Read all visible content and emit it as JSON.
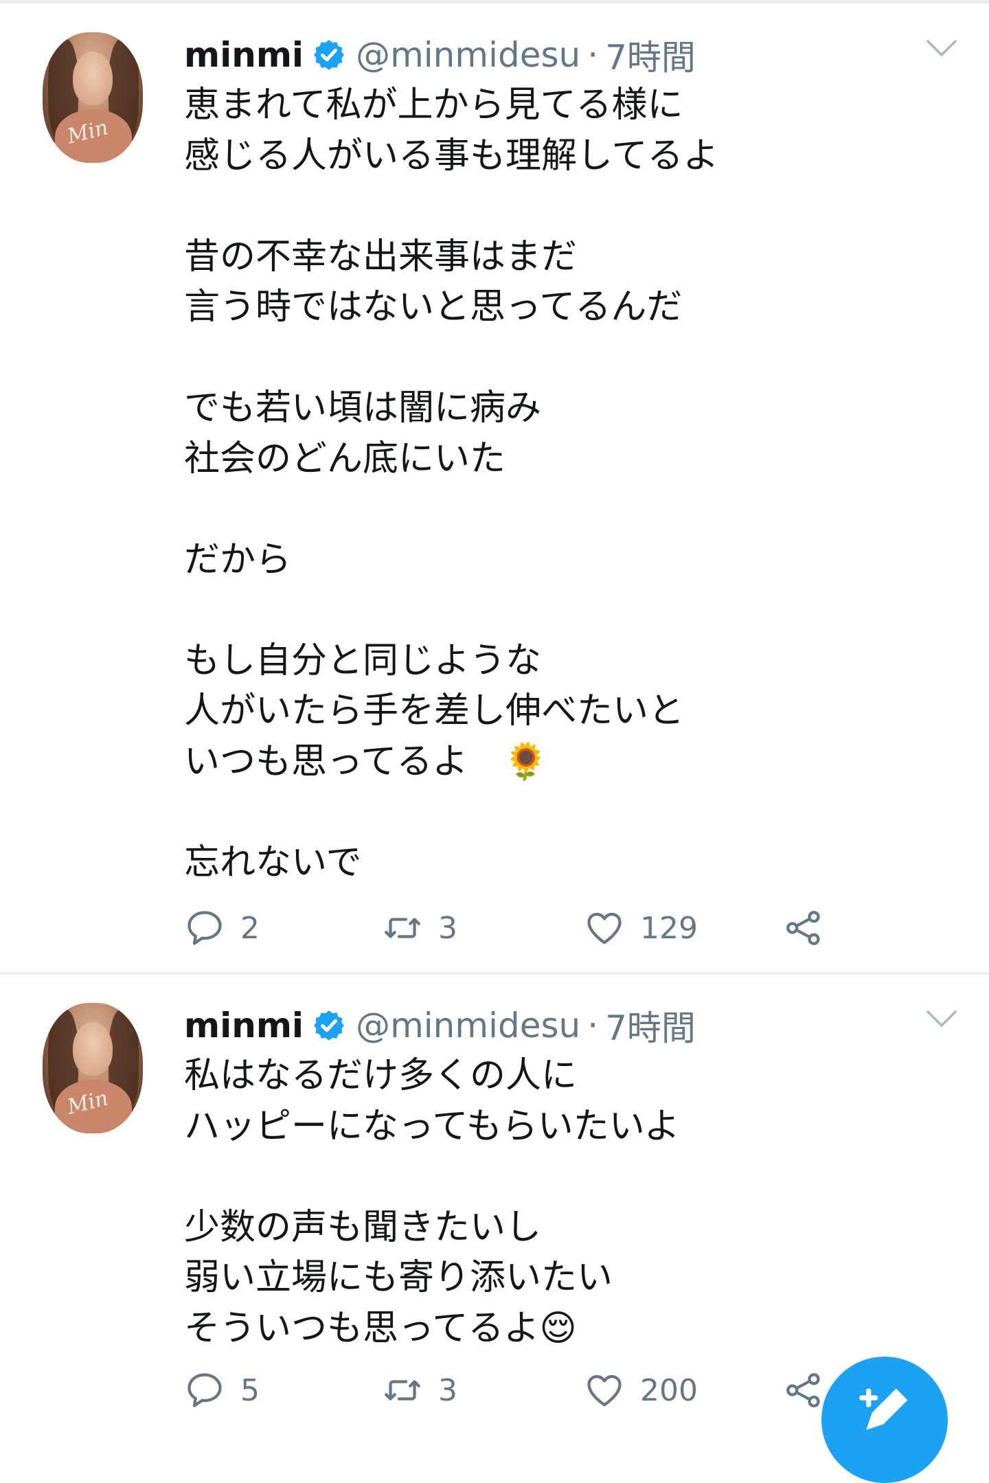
{
  "tweets": [
    {
      "name": "minmi",
      "handle": "@minmidesu",
      "separator": "·",
      "time": "7時間",
      "text": "恵まれて私が上から見てる様に\n感じる人がいる事も理解してるよ\n\n昔の不幸な出来事はまだ\n言う時ではないと思ってるんだ\n\nでも若い頃は闇に病み\n社会のどん底にいた\n\nだから\n\nもし自分と同じような\n人がいたら手を差し伸べたいと\nいつも思ってるよ　🌻\n\n忘れないで",
      "replies": "2",
      "retweets": "3",
      "likes": "129",
      "avatar_signature": "Min"
    },
    {
      "name": "minmi",
      "handle": "@minmidesu",
      "separator": "·",
      "time": "7時間",
      "text": "私はなるだけ多くの人に\nハッピーになってもらいたいよ\n\n少数の声も聞きたいし\n弱い立場にも寄り添いたい\nそういつも思ってるよ😌",
      "replies": "5",
      "retweets": "3",
      "likes": "200",
      "avatar_signature": "Min"
    }
  ],
  "icons": {
    "verified": "verified-badge-icon",
    "reply": "reply-bubble-icon",
    "retweet": "retweet-icon",
    "like": "heart-icon",
    "share": "share-icon",
    "caret": "chevron-down-icon",
    "compose": "compose-tweet-icon"
  },
  "colors": {
    "accent": "#1da1f2",
    "text": "#14171a",
    "muted": "#657786",
    "divider": "#e1e8ed"
  }
}
